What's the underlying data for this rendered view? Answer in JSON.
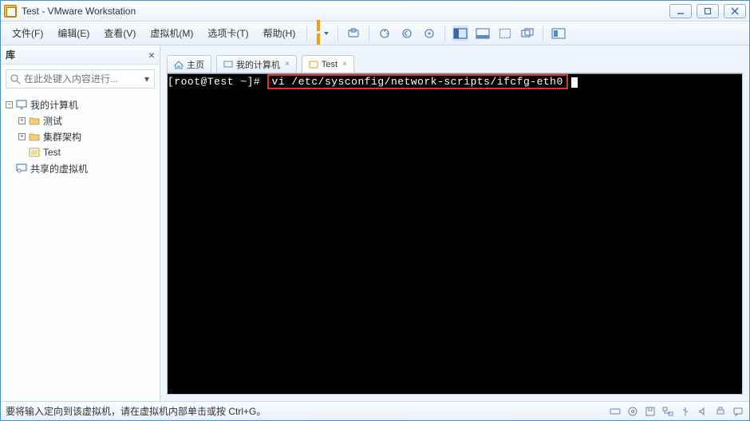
{
  "window": {
    "title": "Test - VMware Workstation"
  },
  "menu": {
    "file": "文件(F)",
    "edit": "编辑(E)",
    "view": "查看(V)",
    "vm": "虚拟机(M)",
    "tabs": "选项卡(T)",
    "help": "帮助(H)"
  },
  "sidebar": {
    "title": "库",
    "search_placeholder": "在此处键入内容进行...",
    "nodes": {
      "my_computer": "我的计算机",
      "test_folder": "测试",
      "cluster": "集群架构",
      "test_vm": "Test",
      "shared": "共享的虚拟机"
    }
  },
  "tabs": {
    "home": "主页",
    "my_computer": "我的计算机",
    "test": "Test"
  },
  "terminal": {
    "prompt": "[root@Test ~]# ",
    "command": "vi /etc/sysconfig/network-scripts/ifcfg-eth0"
  },
  "statusbar": {
    "text": "要将输入定向到该虚拟机，请在虚拟机内部单击或按 Ctrl+G。"
  }
}
